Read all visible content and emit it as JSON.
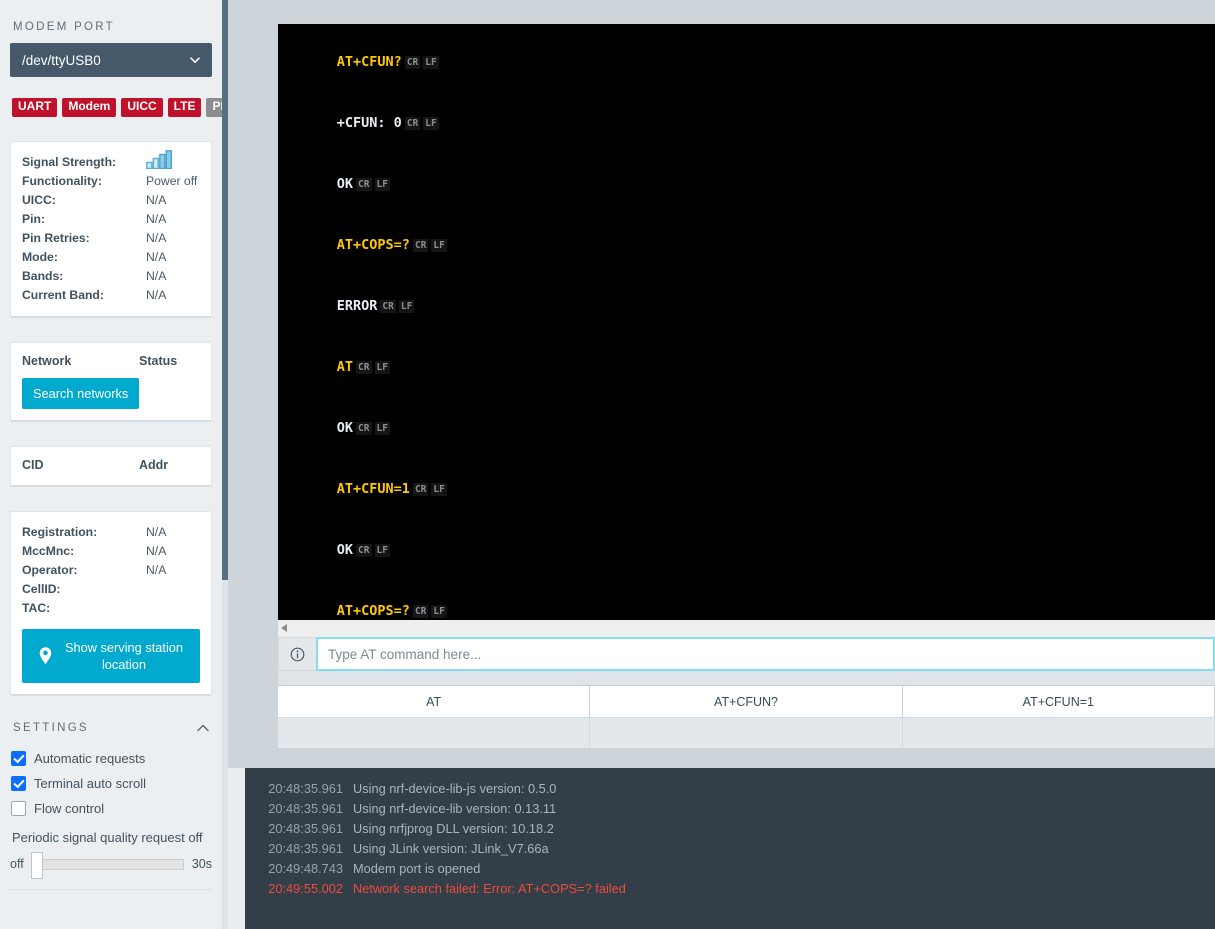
{
  "sidebar": {
    "modem_port_label": "MODEM PORT",
    "port_value": "/dev/ttyUSB0",
    "badges": [
      {
        "label": "UART",
        "state": "error"
      },
      {
        "label": "Modem",
        "state": "error"
      },
      {
        "label": "UICC",
        "state": "error"
      },
      {
        "label": "LTE",
        "state": "error"
      },
      {
        "label": "PDN",
        "state": "inactive"
      }
    ],
    "modem_info": [
      {
        "key": "Signal Strength:",
        "value": ""
      },
      {
        "key": "Functionality:",
        "value": "Power off"
      },
      {
        "key": "UICC:",
        "value": "N/A"
      },
      {
        "key": "Pin:",
        "value": "N/A"
      },
      {
        "key": "Pin Retries:",
        "value": "N/A"
      },
      {
        "key": "Mode:",
        "value": "N/A"
      },
      {
        "key": "Bands:",
        "value": "N/A"
      },
      {
        "key": "Current Band:",
        "value": "N/A"
      }
    ],
    "network_table": {
      "col1": "Network",
      "col2": "Status",
      "search_button": "Search networks"
    },
    "cid_table": {
      "col1": "CID",
      "col2": "Addr"
    },
    "registration_info": [
      {
        "key": "Registration:",
        "value": "N/A"
      },
      {
        "key": "MccMnc:",
        "value": "N/A"
      },
      {
        "key": "Operator:",
        "value": "N/A"
      },
      {
        "key": "CellID:",
        "value": ""
      },
      {
        "key": "TAC:",
        "value": ""
      }
    ],
    "serving_station_button": "Show serving station location",
    "settings": {
      "title": "SETTINGS",
      "checkboxes": [
        {
          "label": "Automatic requests",
          "checked": true
        },
        {
          "label": "Terminal auto scroll",
          "checked": true
        },
        {
          "label": "Flow control",
          "checked": false
        }
      ],
      "periodic_label": "Periodic signal quality request off",
      "slider_min_label": "off",
      "slider_max_label": "30s"
    }
  },
  "terminal": {
    "lines": [
      {
        "text": "AT+CFUN?",
        "kind": "cmd",
        "ctrl": [
          "CR",
          "LF"
        ]
      },
      {
        "text": "+CFUN: 0",
        "kind": "rsp",
        "ctrl": [
          "CR",
          "LF"
        ]
      },
      {
        "text": "OK",
        "kind": "rsp",
        "ctrl": [
          "CR",
          "LF"
        ]
      },
      {
        "text": "AT+COPS=?",
        "kind": "cmd",
        "ctrl": [
          "CR",
          "LF"
        ]
      },
      {
        "text": "ERROR",
        "kind": "rsp",
        "ctrl": [
          "CR",
          "LF"
        ]
      },
      {
        "text": "AT",
        "kind": "cmd",
        "ctrl": [
          "CR",
          "LF"
        ]
      },
      {
        "text": "OK",
        "kind": "rsp",
        "ctrl": [
          "CR",
          "LF"
        ]
      },
      {
        "text": "AT+CFUN=1",
        "kind": "cmd",
        "ctrl": [
          "CR",
          "LF"
        ]
      },
      {
        "text": "OK",
        "kind": "rsp",
        "ctrl": [
          "CR",
          "LF"
        ]
      },
      {
        "text": "AT+COPS=?",
        "kind": "cmd",
        "ctrl": [
          "CR",
          "LF"
        ]
      }
    ]
  },
  "command_bar": {
    "placeholder": "Type AT command here...",
    "value": ""
  },
  "shortcuts": [
    {
      "label": "AT"
    },
    {
      "label": "AT+CFUN?"
    },
    {
      "label": "AT+CFUN=1"
    }
  ],
  "log": {
    "entries": [
      {
        "time": "20:48:35.961",
        "message": "Using nrf-device-lib-js version: 0.5.0",
        "level": "info"
      },
      {
        "time": "20:48:35.961",
        "message": "Using nrf-device-lib version: 0.13.11",
        "level": "info"
      },
      {
        "time": "20:48:35.961",
        "message": "Using nrfjprog DLL version: 10.18.2",
        "level": "info"
      },
      {
        "time": "20:48:35.961",
        "message": "Using JLink version: JLink_V7.66a",
        "level": "info"
      },
      {
        "time": "20:49:48.743",
        "message": "Modem port is opened",
        "level": "info"
      },
      {
        "time": "20:49:55.002",
        "message": "Network search failed: Error: AT+COPS=? failed",
        "level": "error"
      }
    ]
  },
  "colors": {
    "accent": "#00a9ce",
    "error_badge": "#c0112a",
    "inactive_badge": "#8b8d8f",
    "terminal_cmd": "#ffc800",
    "terminal_rsp": "#e8eef2",
    "log_error": "#ef4b3c",
    "sidebar_bg": "#eceff1",
    "log_bg": "#323e48"
  }
}
